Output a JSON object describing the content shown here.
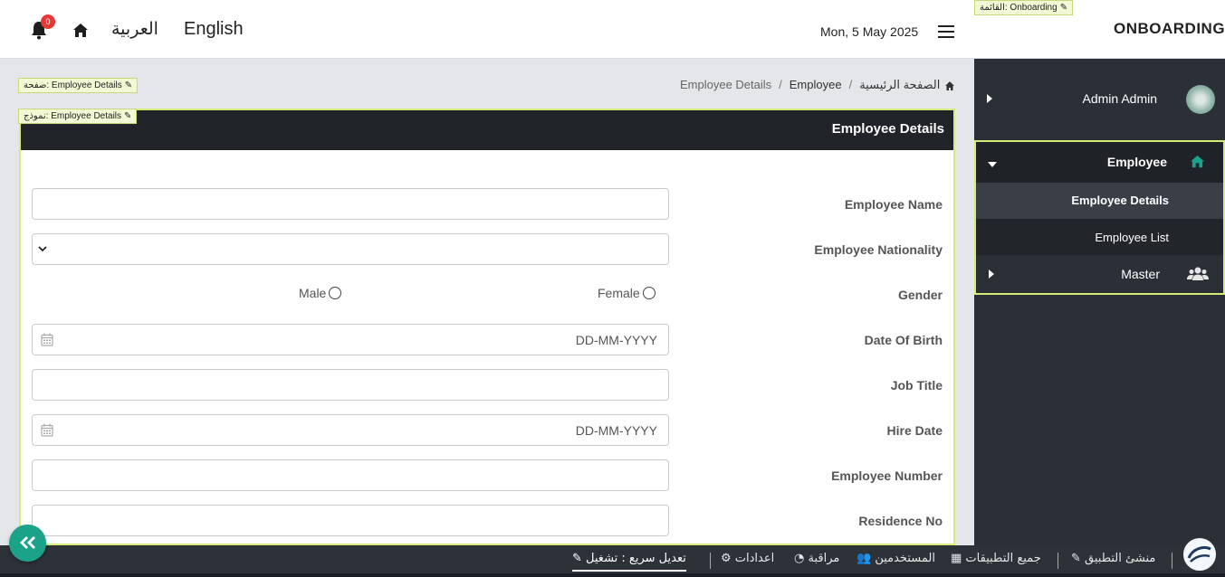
{
  "header": {
    "notification_count": "0",
    "lang_arabic": "العربية",
    "lang_english": "English",
    "date": "Mon, 5 May 2025",
    "brand": "ONBOARDING",
    "menu_tag": "القائمة: Onboarding"
  },
  "sidebar": {
    "user_name": "Admin Admin",
    "items": [
      {
        "label": "Employee",
        "icon": "home-icon"
      },
      {
        "label": "Employee Details"
      },
      {
        "label": "Employee List"
      },
      {
        "label": "Master",
        "icon": "users-icon"
      }
    ]
  },
  "breadcrumb": {
    "home": "الصفحة الرئيسية",
    "section": "Employee",
    "current": "Employee Details",
    "page_tag": "صفحة: Employee Details",
    "form_tag": "نموذج: Employee Details"
  },
  "form": {
    "title": "Employee Details",
    "fields": {
      "name": {
        "label": "Employee Name",
        "value": ""
      },
      "nationality": {
        "label": "Employee Nationality",
        "value": ""
      },
      "gender": {
        "label": "Gender",
        "option_female": "Female",
        "option_male": "Male"
      },
      "dob": {
        "label": "Date Of Birth",
        "placeholder": "DD-MM-YYYY"
      },
      "job_title": {
        "label": "Job Title",
        "value": ""
      },
      "hire_date": {
        "label": "Hire Date",
        "placeholder": "DD-MM-YYYY"
      },
      "employee_number": {
        "label": "Employee Number",
        "value": ""
      },
      "residence_no": {
        "label": "Residence No",
        "value": ""
      }
    }
  },
  "bottombar": {
    "app_builder": "منشئ التطبيق",
    "all_apps": "جميع التطبيقات",
    "users": "المستخدمين",
    "monitor": "مراقبة",
    "settings": "اعدادات",
    "quick_edit": "تعديل سريع : تشغيل"
  },
  "colors": {
    "accent_teal": "#1ba38a",
    "highlight_border": "#d6ec7a",
    "sidebar_bg": "#2b2f36",
    "header_dark": "#202327"
  }
}
